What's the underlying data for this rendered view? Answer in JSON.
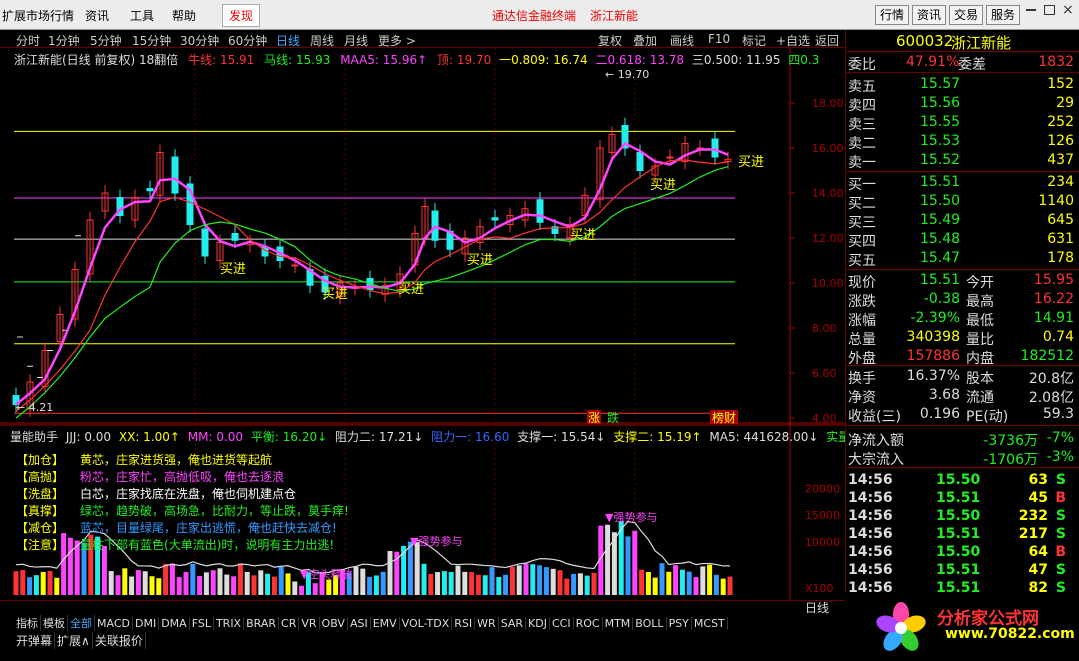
{
  "menubar": {
    "items": [
      "扩展市场行情",
      "资讯",
      "工具",
      "帮助",
      "发现"
    ],
    "promo1": "通达信金融终端",
    "promo2": "浙江新能",
    "right": [
      "行情",
      "资讯",
      "交易",
      "服务"
    ]
  },
  "periods": [
    "分时",
    "1分钟",
    "5分钟",
    "15分钟",
    "30分钟",
    "60分钟",
    "日线",
    "周线",
    "月线",
    "更多 >"
  ],
  "toolbar": [
    "复权",
    "叠加",
    "画线",
    "F10",
    "标记",
    "+自选",
    "返回"
  ],
  "title": {
    "stock": "浙江新能(日线 前复权) 18翻倍",
    "ma": "牛线: 15.91",
    "ma2": "马线: 15.93",
    "maa5": "MAA5: 15.96↑",
    "top": "顶: 19.70",
    "l1": "一0.809: 16.74",
    "l2": "二0.618: 13.78",
    "l3": "三0.500: 11.95",
    "l4": "四0.3"
  },
  "chart_data": {
    "type": "candlestick",
    "price_ticks": [
      "18.00",
      "16.00",
      "14.00",
      "12.00",
      "10.00",
      "8.00",
      "6.00",
      "4.00"
    ],
    "annotations": [
      "19.70",
      "4.21",
      "买进",
      "买进",
      "买进",
      "买进",
      "买进",
      "买进",
      "涨",
      "跌",
      "榜财"
    ],
    "volume_ticks": [
      "20000",
      "15000",
      "10000",
      "X100"
    ],
    "vol_annotations": [
      "强势参与",
      "强势参与",
      "空头释放",
      "极"
    ],
    "dates": [
      "2021年",
      "7",
      "8",
      "9",
      "10"
    ]
  },
  "vol_title": {
    "name": "量能助手",
    "jjj": "JJJ: 0.00",
    "xx": "XX: 1.00↑",
    "mm": "MM: 0.00",
    "ph": "平衡: 16.20↓",
    "zl2": "阻力二: 17.21↓",
    "zl1": "阻力一: 16.60",
    "zc1": "支撑一: 15.54↓",
    "zc2": "支撑二: 15.19↑",
    "ma5": "MA5: 441628.00↓",
    "sl": "实量"
  },
  "legend": [
    {
      "tag": "【加仓】",
      "text": "黄芯，庄家进货强，俺也进货等起航",
      "color": "#ffff00"
    },
    {
      "tag": "【高抛】",
      "text": "粉芯，庄家忙，高抛低吸，俺也去逐浪",
      "color": "#ff44ff"
    },
    {
      "tag": "【洗盘】",
      "text": "白芯，庄家找底在洗盘，俺也伺机建点仓",
      "color": "#ffffff"
    },
    {
      "tag": "【真撑】",
      "text": "绿芯，趋势破，高场急，比耐力，等止跌，莫手痒!",
      "color": "#22ee22"
    },
    {
      "tag": "【减仓】",
      "text": "蓝芯，目量绿尾，庄家出逃慌，俺也赶快去减仓!",
      "color": "#3399ff"
    },
    {
      "tag": "【注意】",
      "text": "量柱下部有蓝色(大单流出)时，说明有主力出逃!",
      "color": "#22ee22"
    }
  ],
  "ticker": {
    "code": "600032",
    "name": "浙江新能"
  },
  "wb": {
    "l1": "委比",
    "v1": "47.91%",
    "l2": "委差",
    "v2": "1832"
  },
  "asks": [
    {
      "l": "卖五",
      "p": "15.57",
      "v": "152"
    },
    {
      "l": "卖四",
      "p": "15.56",
      "v": "29"
    },
    {
      "l": "卖三",
      "p": "15.55",
      "v": "252"
    },
    {
      "l": "卖二",
      "p": "15.53",
      "v": "126"
    },
    {
      "l": "卖一",
      "p": "15.52",
      "v": "437"
    }
  ],
  "bids": [
    {
      "l": "买一",
      "p": "15.51",
      "v": "234"
    },
    {
      "l": "买二",
      "p": "15.50",
      "v": "1140"
    },
    {
      "l": "买三",
      "p": "15.49",
      "v": "645"
    },
    {
      "l": "买四",
      "p": "15.48",
      "v": "631"
    },
    {
      "l": "买五",
      "p": "15.47",
      "v": "178"
    }
  ],
  "stats": [
    {
      "l1": "现价",
      "v1": "15.51",
      "c1": "#22ee22",
      "l2": "今开",
      "v2": "15.95",
      "c2": "#ff3333"
    },
    {
      "l1": "涨跌",
      "v1": "-0.38",
      "c1": "#22ee22",
      "l2": "最高",
      "v2": "16.22",
      "c2": "#ff3333"
    },
    {
      "l1": "涨幅",
      "v1": "-2.39%",
      "c1": "#22ee22",
      "l2": "最低",
      "v2": "14.91",
      "c2": "#22ee22"
    },
    {
      "l1": "总量",
      "v1": "340398",
      "c1": "#ffff00",
      "l2": "量比",
      "v2": "0.74",
      "c2": "#ffff00"
    },
    {
      "l1": "外盘",
      "v1": "157886",
      "c1": "#ff3333",
      "l2": "内盘",
      "v2": "182512",
      "c2": "#22ee22"
    }
  ],
  "stats2": [
    {
      "l1": "换手",
      "v1": "16.37%",
      "l2": "股本",
      "v2": "20.8亿"
    },
    {
      "l1": "净资",
      "v1": "3.68",
      "l2": "流通",
      "v2": "2.08亿"
    },
    {
      "l1": "收益(三)",
      "v1": "0.196",
      "l2": "PE(动)",
      "v2": "59.3"
    }
  ],
  "flows": [
    {
      "l": "净流入额",
      "v": "-3736万",
      "p": "-7%"
    },
    {
      "l": "大宗流入",
      "v": "-1706万",
      "p": "-3%"
    }
  ],
  "ticks": [
    {
      "t": "14:56",
      "p": "15.50",
      "v": "63",
      "s": "S"
    },
    {
      "t": "14:56",
      "p": "15.51",
      "v": "45",
      "s": "B"
    },
    {
      "t": "14:56",
      "p": "15.50",
      "v": "232",
      "s": "S"
    },
    {
      "t": "14:56",
      "p": "15.51",
      "v": "217",
      "s": "S"
    },
    {
      "t": "14:56",
      "p": "15.50",
      "v": "64",
      "s": "B"
    },
    {
      "t": "14:56",
      "p": "15.51",
      "v": "47",
      "s": "S"
    },
    {
      "t": "14:56",
      "p": "15.51",
      "v": "82",
      "s": "S"
    }
  ],
  "bottom_tabs": [
    "指标",
    "模板",
    "全部",
    "MACD",
    "DMI",
    "DMA",
    "FSL",
    "TRIX",
    "BRAR",
    "CR",
    "VR",
    "OBV",
    "ASI",
    "EMV",
    "VOL-TDX",
    "RSI",
    "WR",
    "SAR",
    "KDJ",
    "CCI",
    "ROC",
    "MTM",
    "BOLL",
    "PSY",
    "MCST"
  ],
  "bottom_tabs2": [
    "开弹幕",
    "扩展∧",
    "关联报价"
  ],
  "brand": {
    "name": "分析家公式网",
    "url": "www.70822.com"
  },
  "rline": "日线"
}
